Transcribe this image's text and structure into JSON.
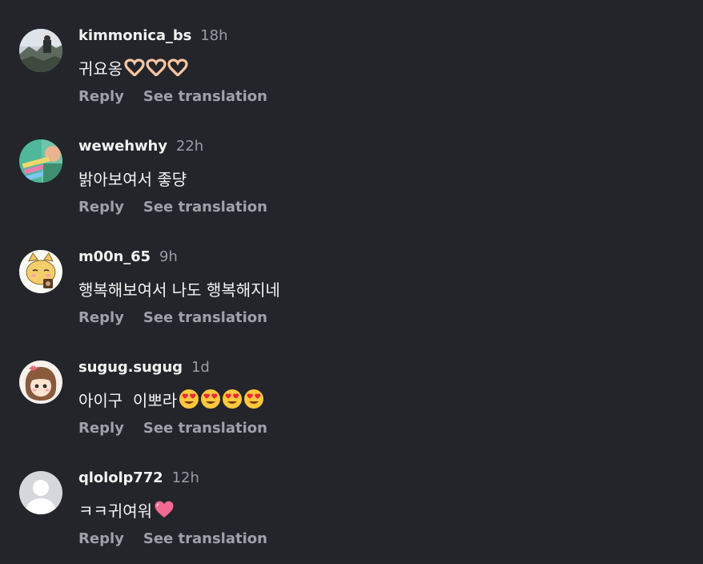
{
  "colors": {
    "background": "#23252a",
    "username": "#f2f2f2",
    "timestamp": "#9a9ca3",
    "action": "#9fa1a8"
  },
  "comments": [
    {
      "username": "kimmonica_bs",
      "time": "18h",
      "text": "귀요옹",
      "emoji": [
        "heart-hands",
        "heart-hands",
        "heart-hands"
      ],
      "reply_label": "Reply",
      "translate_label": "See translation",
      "avatar": "photo-avatar"
    },
    {
      "username": "wewehwhy",
      "time": "22h",
      "text": "밝아보여서 좋댱",
      "emoji": [],
      "reply_label": "Reply",
      "translate_label": "See translation",
      "avatar": "colorful-avatar"
    },
    {
      "username": "m00n_65",
      "time": "9h",
      "text": "행복해보여서 나도 행복해지네",
      "emoji": [],
      "reply_label": "Reply",
      "translate_label": "See translation",
      "avatar": "cat-avatar"
    },
    {
      "username": "sugug.sugug",
      "time": "1d",
      "text": "아이구  이뽀라",
      "emoji": [
        "heart-eyes",
        "heart-eyes",
        "heart-eyes",
        "heart-eyes"
      ],
      "reply_label": "Reply",
      "translate_label": "See translation",
      "avatar": "girl-avatar"
    },
    {
      "username": "qlololp772",
      "time": "12h",
      "text": "ㅋㅋ귀여워",
      "emoji": [
        "pink-heart"
      ],
      "reply_label": "Reply",
      "translate_label": "See translation",
      "avatar": "default-avatar"
    }
  ]
}
